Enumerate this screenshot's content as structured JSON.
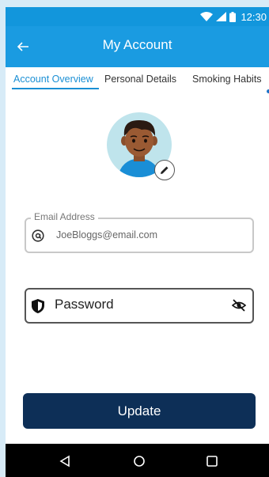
{
  "status_bar": {
    "time": "12:30",
    "icons": [
      "wifi-icon",
      "signal-icon",
      "battery-icon"
    ]
  },
  "app_bar": {
    "title": "My Account",
    "back_icon": "arrow-left-icon"
  },
  "tabs": [
    {
      "label": "Account Overview",
      "active": true
    },
    {
      "label": "Personal Details",
      "active": false
    },
    {
      "label": "Smoking Habits",
      "active": false
    }
  ],
  "profile": {
    "avatar_icon": "user-avatar-illustration",
    "edit_icon": "pencil-icon"
  },
  "email": {
    "label": "Email Address",
    "value": "JoeBloggs@email.com",
    "icon": "at-sign-icon"
  },
  "password": {
    "placeholder": "Password",
    "icon": "shield-icon",
    "toggle_icon": "eye-off-icon"
  },
  "update_button": {
    "label": "Update"
  },
  "nav_bar": {
    "icons": [
      "back-triangle-icon",
      "home-circle-icon",
      "recents-square-icon"
    ]
  },
  "colors": {
    "primary": "#1a9be1",
    "button": "#0d2f57",
    "tab_active": "#1a8fd4",
    "background": "#d7ebf7"
  }
}
